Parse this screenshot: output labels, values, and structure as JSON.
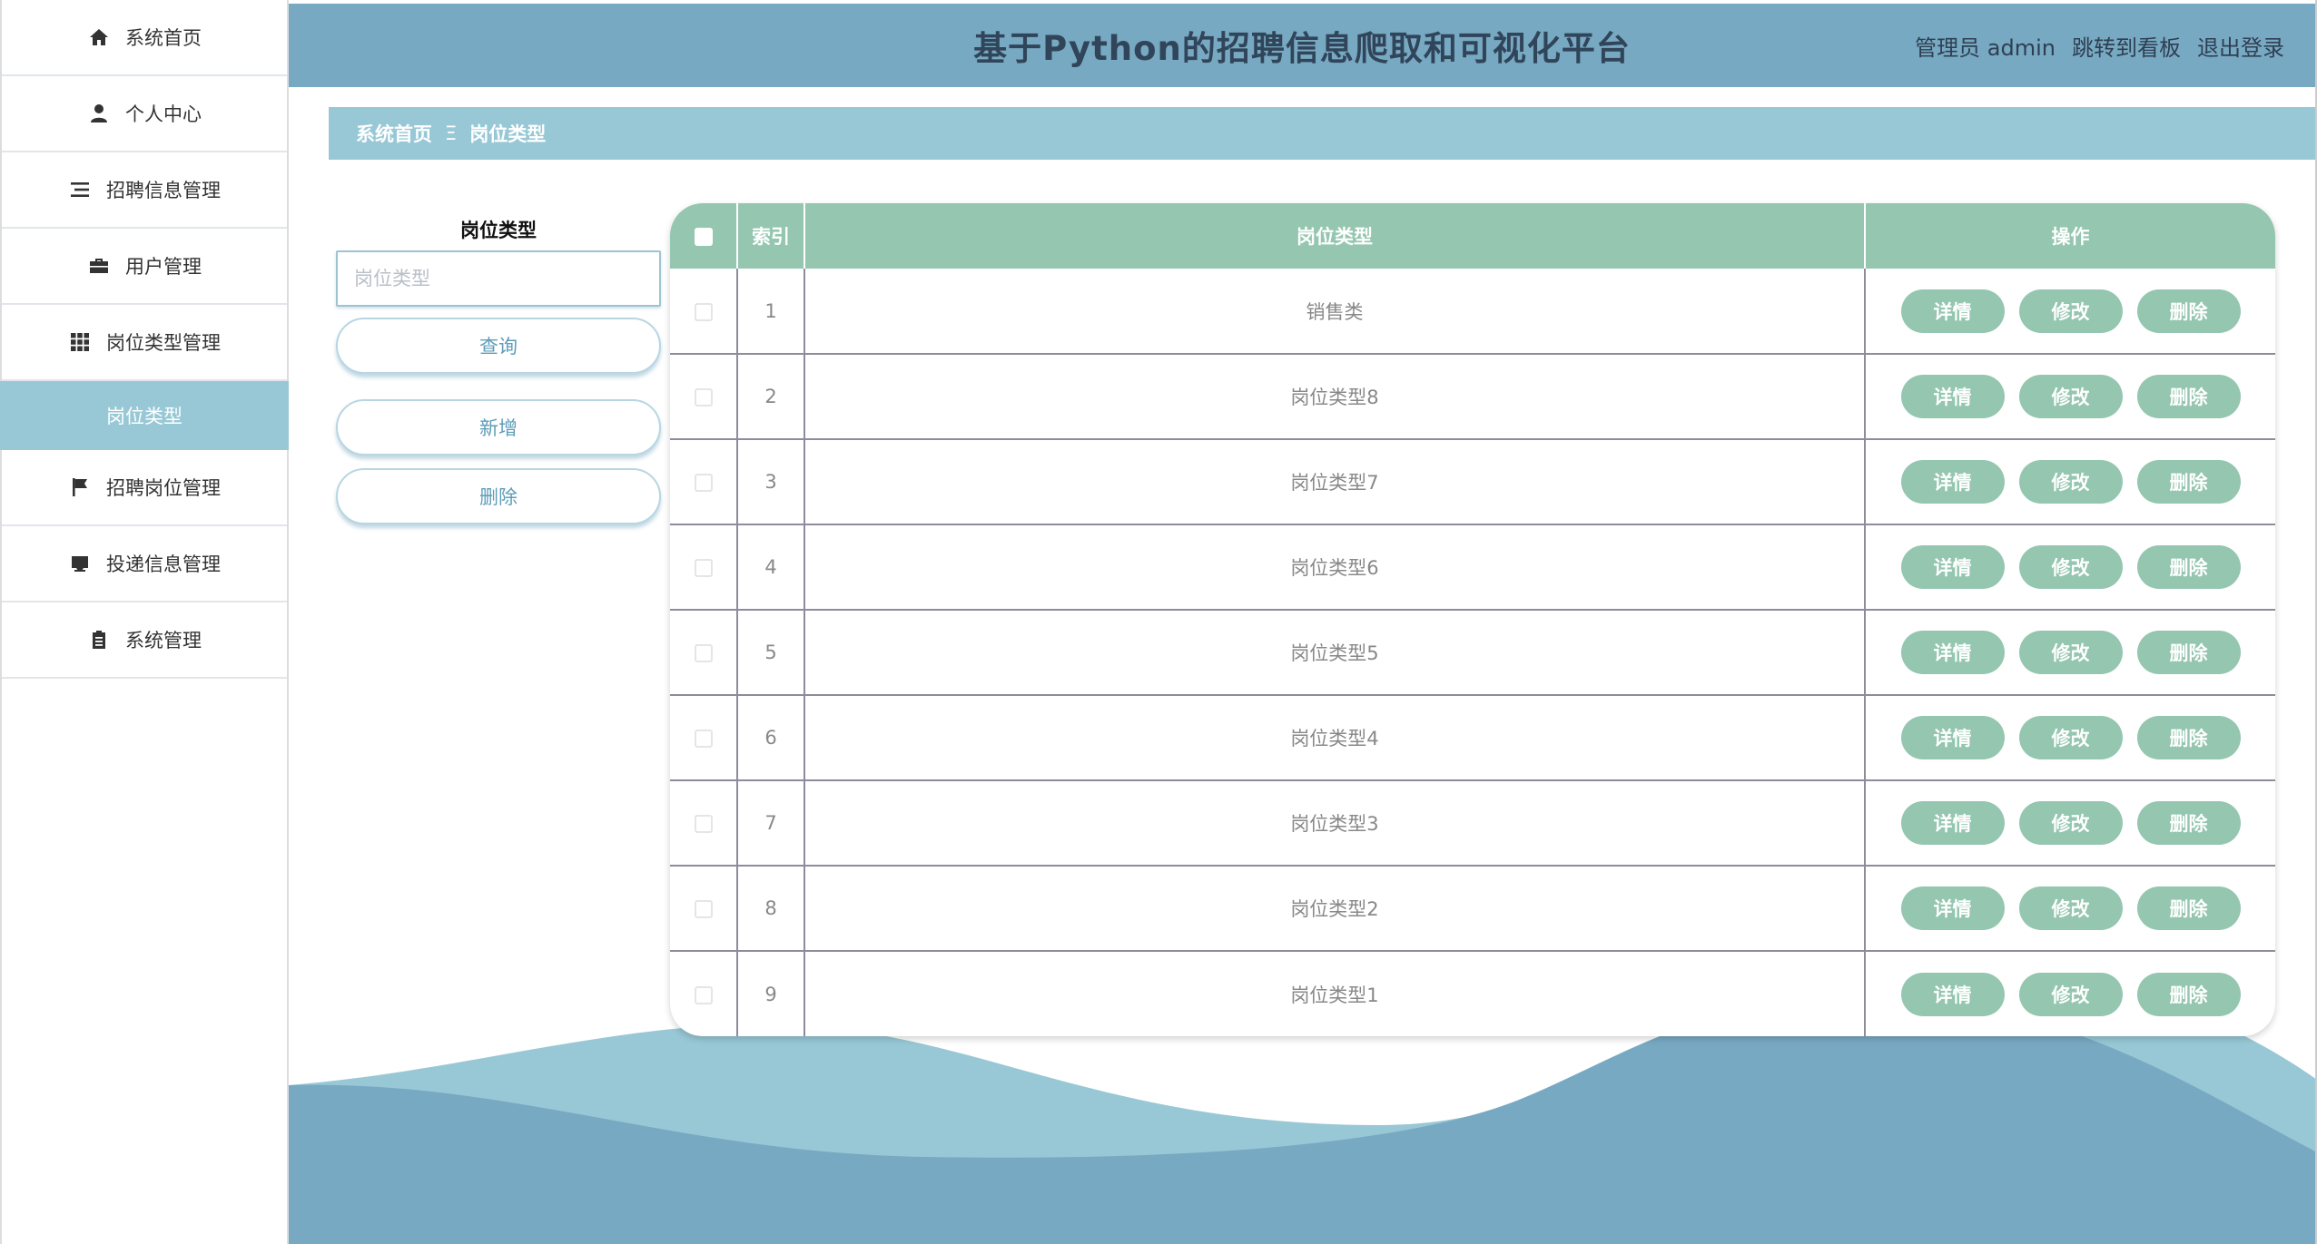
{
  "app": {
    "title": "基于Python的招聘信息爬取和可视化平台",
    "admin_label": "管理员 admin",
    "dashboard_link": "跳转到看板",
    "logout_link": "退出登录"
  },
  "sidebar": {
    "items": [
      {
        "label": "系统首页",
        "icon": "home-icon"
      },
      {
        "label": "个人中心",
        "icon": "user-icon"
      },
      {
        "label": "招聘信息管理",
        "icon": "list-icon"
      },
      {
        "label": "用户管理",
        "icon": "briefcase-icon"
      },
      {
        "label": "岗位类型管理",
        "icon": "grid-icon"
      },
      {
        "label": "招聘岗位管理",
        "icon": "flag-icon"
      },
      {
        "label": "投递信息管理",
        "icon": "inbox-icon"
      },
      {
        "label": "系统管理",
        "icon": "clipboard-icon"
      }
    ],
    "active_sub": "岗位类型"
  },
  "breadcrumb": {
    "home": "系统首页",
    "separator": "Ξ",
    "current": "岗位类型"
  },
  "search": {
    "label": "岗位类型",
    "placeholder": "岗位类型",
    "value": "",
    "query_button": "查询",
    "add_button": "新增",
    "delete_button": "删除"
  },
  "table": {
    "headers": {
      "index": "索引",
      "type": "岗位类型",
      "ops": "操作"
    },
    "op_labels": {
      "detail": "详情",
      "edit": "修改",
      "delete": "删除"
    },
    "rows": [
      {
        "index": "1",
        "type": "销售类"
      },
      {
        "index": "2",
        "type": "岗位类型8"
      },
      {
        "index": "3",
        "type": "岗位类型7"
      },
      {
        "index": "4",
        "type": "岗位类型6"
      },
      {
        "index": "5",
        "type": "岗位类型5"
      },
      {
        "index": "6",
        "type": "岗位类型4"
      },
      {
        "index": "7",
        "type": "岗位类型3"
      },
      {
        "index": "8",
        "type": "岗位类型2"
      },
      {
        "index": "9",
        "type": "岗位类型1"
      }
    ]
  },
  "colors": {
    "topbar": "#78a9c2",
    "breadcrumb": "#98c8d6",
    "table_header": "#94c6b0",
    "wave_light": "#98c8d6",
    "wave_dark": "#78a9c2"
  }
}
